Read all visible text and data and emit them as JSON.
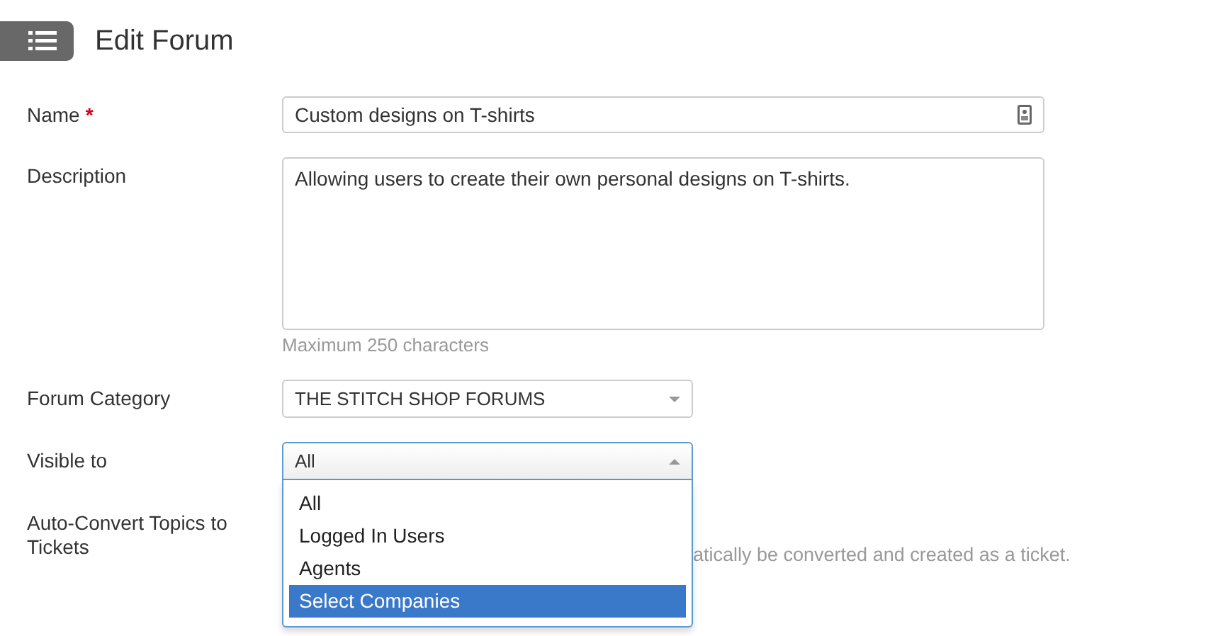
{
  "header": {
    "title": "Edit Forum"
  },
  "fields": [
    {
      "kind": "text",
      "label": "Name",
      "required": true,
      "required_mark": "*",
      "value": "Custom designs on T-shirts"
    },
    {
      "kind": "textarea",
      "label": "Description",
      "value": "Allowing users to create their own personal designs on T-shirts.",
      "hint": "Maximum 250 characters"
    },
    {
      "kind": "select",
      "label": "Forum Category",
      "value": "THE STITCH SHOP FORUMS",
      "expanded": false
    },
    {
      "kind": "select",
      "label": "Visible to",
      "value": "All",
      "expanded": true,
      "options": [
        {
          "label": "All",
          "highlighted": false
        },
        {
          "label": "Logged In Users",
          "highlighted": false
        },
        {
          "label": "Agents",
          "highlighted": false
        },
        {
          "label": "Select Companies",
          "highlighted": true
        }
      ]
    },
    {
      "kind": "note",
      "label": "Auto-Convert Topics to Tickets",
      "hint": "atically be converted and created as a ticket."
    }
  ]
}
